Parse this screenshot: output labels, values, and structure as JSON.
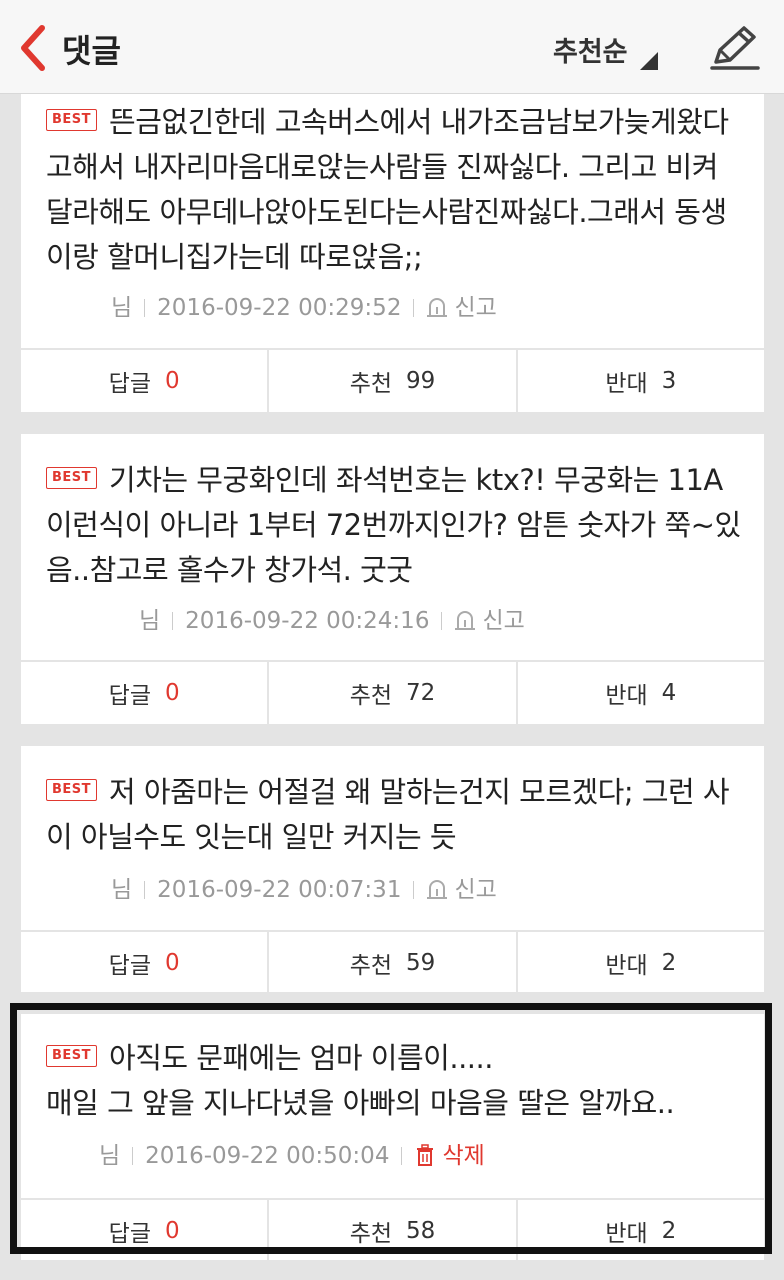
{
  "header": {
    "title": "댓글",
    "sort_label": "추천순"
  },
  "colors": {
    "accent": "#e0382f",
    "background": "#e4e4e4"
  },
  "comments": [
    {
      "badge": "BEST",
      "text": "뜬금없긴한데 고속버스에서 내가조금남보가늦게왔다고해서 내자리마음대로앉는사람들 진짜싫다. 그리고 비켜달라해도 아무데나앉아도된다는사람진짜싫다.그래서 동생이랑 할머니집가는데 따로앉음;;",
      "author_suffix": "님",
      "date": "2016-09-22 00:29:52",
      "action_label": "신고",
      "reply_label": "답글",
      "reply_count": "0",
      "up_label": "추천",
      "up_count": "99",
      "down_label": "반대",
      "down_count": "3"
    },
    {
      "badge": "BEST",
      "text": "기차는 무궁화인데 좌석번호는 ktx?! 무궁화는 11A 이런식이 아니라 1부터 72번까지인가? 암튼 숫자가 쭉~있음..참고로 홀수가 창가석. 굿굿",
      "author_suffix": "님",
      "date": "2016-09-22 00:24:16",
      "action_label": "신고",
      "reply_label": "답글",
      "reply_count": "0",
      "up_label": "추천",
      "up_count": "72",
      "down_label": "반대",
      "down_count": "4"
    },
    {
      "badge": "BEST",
      "text": "저 아줌마는 어절걸 왜 말하는건지 모르겠다; 그런 사이 아닐수도 잇는대 일만 커지는 듯",
      "author_suffix": "님",
      "date": "2016-09-22 00:07:31",
      "action_label": "신고",
      "reply_label": "답글",
      "reply_count": "0",
      "up_label": "추천",
      "up_count": "59",
      "down_label": "반대",
      "down_count": "2"
    },
    {
      "badge": "BEST",
      "text_line1": "아직도 문패에는 엄마 이름이.....",
      "text_line2": "매일 그 앞을 지나다녔을 아빠의 마음을 딸은 알까요..",
      "author_suffix": "님",
      "date": "2016-09-22 00:50:04",
      "action_label": "삭제",
      "reply_label": "답글",
      "reply_count": "0",
      "up_label": "추천",
      "up_count": "58",
      "down_label": "반대",
      "down_count": "2"
    }
  ]
}
